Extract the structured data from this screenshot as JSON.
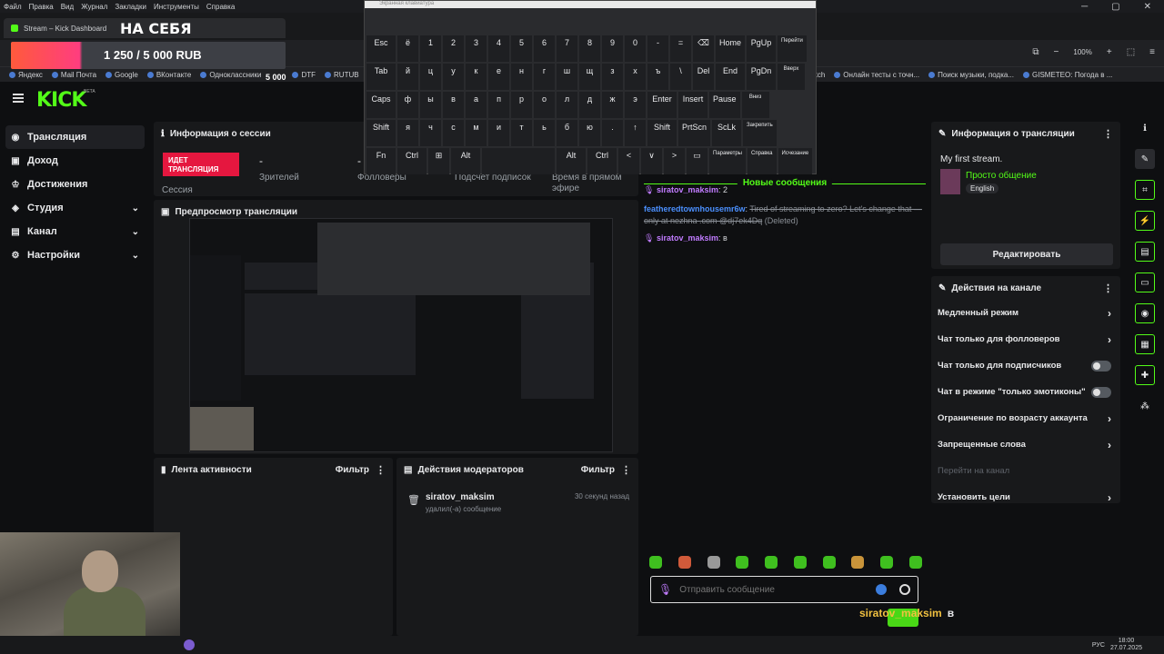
{
  "browser": {
    "menu": [
      "Файл",
      "Правка",
      "Вид",
      "Журнал",
      "Закладки",
      "Инструменты",
      "Справка"
    ],
    "tab_title": "Stream – Kick Dashboard",
    "zoom": "100%",
    "bookmarks": [
      "Яндекс",
      "Mail Почта",
      "Google",
      "ВКонтакте",
      "Одноклассники",
      "DTF",
      "RUTUB",
      "Twitch",
      "Онлайн тесты с точн...",
      "Поиск музыки, подка...",
      "GISMETEO: Погода в ..."
    ]
  },
  "overlay": {
    "title": "НА СЕБЯ",
    "goal": "1 250 / 5 000 RUB",
    "goal_count": "5 000",
    "chat_user": "siratov_maksim",
    "chat_text": "в"
  },
  "keyboard": {
    "title": "Экранная клавиатура",
    "row1": [
      "Esc",
      "ё",
      "1",
      "2",
      "3",
      "4",
      "5",
      "6",
      "7",
      "8",
      "9",
      "0",
      "-",
      "=",
      "⌫",
      "Home",
      "PgUp",
      "Перейти"
    ],
    "row2": [
      "Tab",
      "й",
      "ц",
      "у",
      "к",
      "е",
      "н",
      "г",
      "ш",
      "щ",
      "з",
      "х",
      "ъ",
      "\\",
      "Del",
      "End",
      "PgDn",
      "Вверх"
    ],
    "row3": [
      "Caps",
      "ф",
      "ы",
      "в",
      "а",
      "п",
      "р",
      "о",
      "л",
      "д",
      "ж",
      "э",
      "Enter",
      "Insert",
      "Pause",
      "Вниз"
    ],
    "row4": [
      "Shift",
      "я",
      "ч",
      "с",
      "м",
      "и",
      "т",
      "ь",
      "б",
      "ю",
      ".",
      "↑",
      "Shift",
      "PrtScn",
      "ScLk",
      "Закрепить"
    ],
    "row5": [
      "Fn",
      "Ctrl",
      "⊞",
      "Alt",
      "",
      "Alt",
      "Ctrl",
      "<",
      "∨",
      ">",
      "▭",
      "Параметры",
      "Справка",
      "Исчезание"
    ]
  },
  "kick": {
    "logo": "KICK",
    "beta": "BETA",
    "nav": [
      {
        "label": "Трансляция",
        "icon": "broadcast-icon"
      },
      {
        "label": "Доход",
        "icon": "money-icon"
      },
      {
        "label": "Достижения",
        "icon": "trophy-icon"
      },
      {
        "label": "Студия",
        "icon": "studio-icon"
      },
      {
        "label": "Канал",
        "icon": "channel-icon"
      },
      {
        "label": "Настройки",
        "icon": "gear-icon"
      }
    ],
    "session": {
      "title": "Информация о сессии",
      "live": "ИДЕТ ТРАНСЛЯЦИЯ",
      "session_label": "Сессия",
      "viewers_label": "Зрителей",
      "viewers_value": "-",
      "followers_label": "Фолловеры",
      "followers_value": "-",
      "subs_label": "Подсчет подписок",
      "time_label": "Время в прямом эфире"
    },
    "preview_title": "Предпросмотр трансляции",
    "activity": {
      "title": "Лента активности",
      "filter": "Фильтр"
    },
    "mod": {
      "title": "Действия модераторов",
      "filter": "Фильтр",
      "user": "siratov_maksim",
      "time": "30 секунд назад",
      "action": "удалил(-а) сообщение"
    },
    "chat": {
      "new_messages": "Новые сообщения",
      "messages": [
        {
          "user": "siratov_maksim",
          "text": "2"
        },
        {
          "user": "featheredtownhousemr6w",
          "text": "Tired of streaming to zero? Let's change that — only at nezhna .com @dj7ek4Dq",
          "deleted": "(Deleted)"
        },
        {
          "user": "siratov_maksim",
          "text": "в"
        }
      ],
      "placeholder": "Отправить сообщение"
    },
    "stream_info": {
      "title": "Информация о трансляции",
      "stream_title": "My first stream.",
      "category": "Просто общение",
      "language": "English",
      "edit": "Редактировать"
    },
    "channel_actions": {
      "title": "Действия на канале",
      "items": [
        {
          "label": "Медленный режим",
          "kind": "chev"
        },
        {
          "label": "Чат только для фолловеров",
          "kind": "chev"
        },
        {
          "label": "Чат только для подписчиков",
          "kind": "toggle"
        },
        {
          "label": "Чат в режиме \"только эмотиконы\"",
          "kind": "toggle"
        },
        {
          "label": "Ограничение по возрасту аккаунта",
          "kind": "chev"
        },
        {
          "label": "Запрещенные слова",
          "kind": "chev"
        },
        {
          "label": "Перейти на канал",
          "kind": "dim"
        },
        {
          "label": "Установить цели",
          "kind": "chev"
        }
      ]
    }
  },
  "taskbar": {
    "lang": "РУС",
    "time": "18:00",
    "date": "27.07.2025"
  }
}
